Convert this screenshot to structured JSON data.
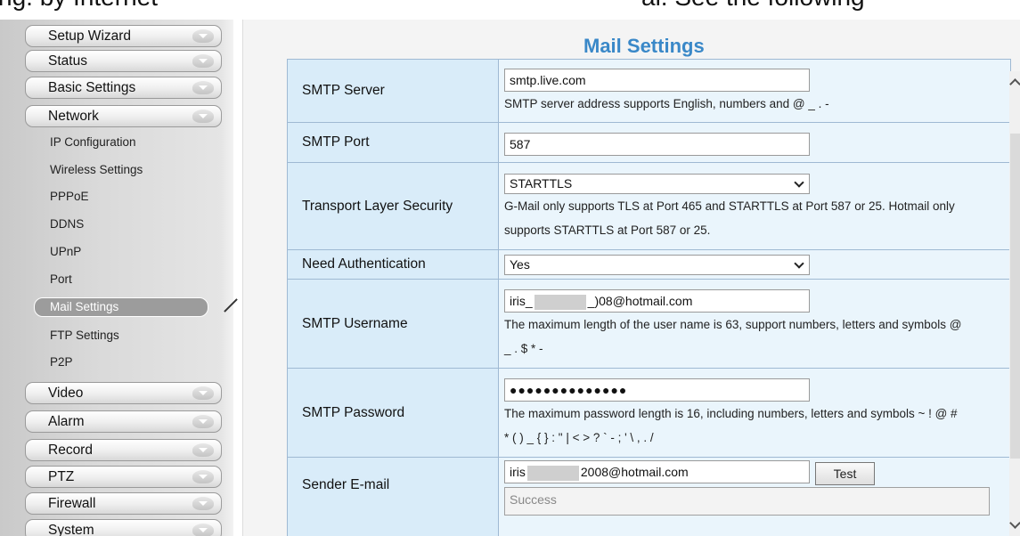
{
  "caption": {
    "left": "ng: by Internet",
    "right": "al. See the following"
  },
  "sidebar": {
    "menu": {
      "setup_wizard": "Setup Wizard",
      "status": "Status",
      "basic_settings": "Basic Settings",
      "network": "Network",
      "video": "Video",
      "alarm": "Alarm",
      "record": "Record",
      "ptz": "PTZ",
      "firewall": "Firewall",
      "system": "System"
    },
    "network_items": {
      "ip_configuration": "IP Configuration",
      "wireless_settings": "Wireless Settings",
      "pppoe": "PPPoE",
      "ddns": "DDNS",
      "upnp": "UPnP",
      "port": "Port",
      "mail_settings": "Mail Settings",
      "ftp_settings": "FTP Settings",
      "p2p": "P2P"
    },
    "active_item": "Mail Settings"
  },
  "page": {
    "title": "Mail Settings"
  },
  "form": {
    "smtp_server": {
      "label": "SMTP Server",
      "value": "smtp.live.com",
      "hint": "SMTP server address supports English, numbers and @ _ . -"
    },
    "smtp_port": {
      "label": "SMTP Port",
      "value": "587"
    },
    "tls": {
      "label": "Transport Layer Security",
      "value": "STARTTLS",
      "hint_line1": "G-Mail only supports TLS at Port 465 and STARTTLS at Port 587 or 25. Hotmail only",
      "hint_line2": "supports STARTTLS at Port 587 or 25."
    },
    "auth": {
      "label": "Need Authentication",
      "value": "Yes"
    },
    "username": {
      "label": "SMTP Username",
      "value_prefix": "iris_",
      "value_mid": "_",
      "value_suffix": ")08@hotmail.com",
      "hint_line1": "The maximum length of the user name is 63, support numbers, letters and symbols @",
      "hint_line2": "_ . $ * -"
    },
    "password": {
      "label": "SMTP Password",
      "value": "●●●●●●●●●●●●●●",
      "hint_line1": "The maximum password length is 16, including numbers, letters and symbols ~ ! @ #",
      "hint_line2": "* ( ) _ { } : \" | < > ? ` - ; ' \\ , . /"
    },
    "sender": {
      "label": "Sender E-mail",
      "value_prefix": "iris",
      "value_suffix": "2008@hotmail.com",
      "test_label": "Test",
      "result": "Success"
    }
  },
  "colors": {
    "title": "#3a88c8",
    "label_bg": "#d9ecf9",
    "value_bg": "#eaf5fc",
    "active_bg": "#9c9c9c"
  }
}
